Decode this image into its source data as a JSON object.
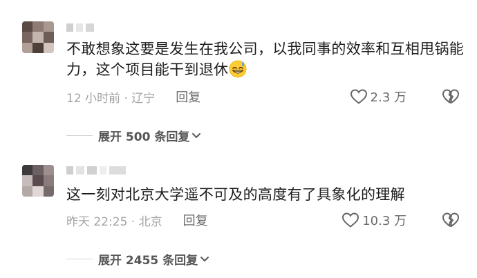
{
  "comments": [
    {
      "text": "不敢想象这要是发生在我公司，以我同事的效率和互相甩锅能力，这个项目能干到退休",
      "emoji": "grinning-sweat-emoji",
      "time_location": "12 小时前 · 辽宁",
      "reply_label": "回复",
      "like_count": "2.3 万",
      "expand_label": "展开 500 条回复"
    },
    {
      "text": "这一刻对北京大学遥不可及的高度有了具象化的理解",
      "time_location": "昨天 22:25 · 北京",
      "reply_label": "回复",
      "like_count": "10.3 万",
      "expand_label": "展开 2455 条回复"
    }
  ],
  "icons": {
    "like": "heart-outline-icon",
    "dislike": "broken-heart-icon",
    "expand": "chevron-down-icon"
  },
  "colors": {
    "text": "#1c1c1c",
    "meta": "#a3a3a3",
    "action": "#6b6b6b"
  }
}
